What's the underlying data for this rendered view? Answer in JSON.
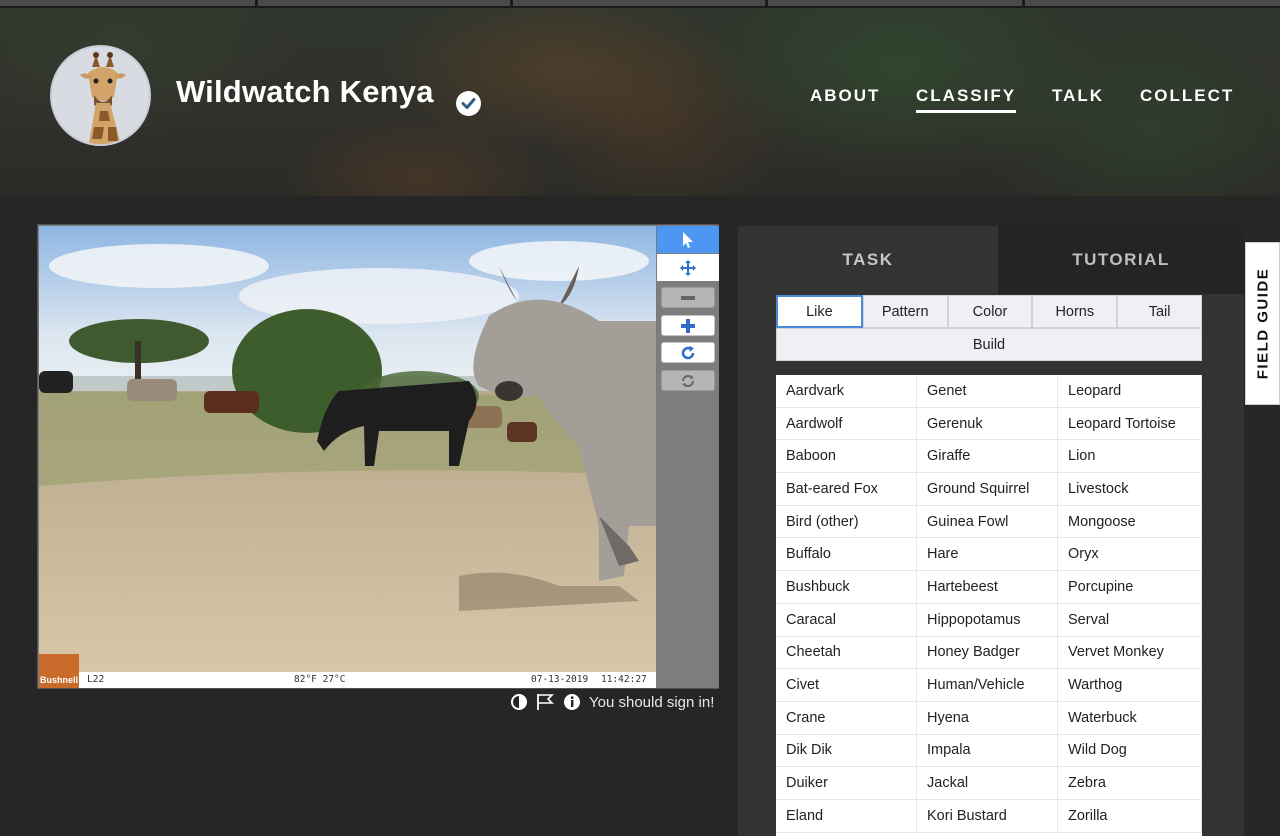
{
  "header": {
    "title": "Wildwatch Kenya",
    "nav": [
      {
        "label": "ABOUT",
        "active": false
      },
      {
        "label": "CLASSIFY",
        "active": true
      },
      {
        "label": "TALK",
        "active": false
      },
      {
        "label": "COLLECT",
        "active": false
      }
    ]
  },
  "subject": {
    "camera_brand": "Bushnell",
    "camera_id": "L22",
    "temperature": "82°F 27°C",
    "date": "07-13-2019",
    "time": "11:42:27"
  },
  "toolbar": {
    "tools": [
      "pointer-icon",
      "move-icon",
      "zoom-out-icon",
      "zoom-in-icon",
      "rotate-icon",
      "reset-icon"
    ],
    "accent": "#4d97f2"
  },
  "subject_meta": {
    "signin_text": "You should sign in!"
  },
  "task": {
    "tabs": [
      "TASK",
      "TUTORIAL"
    ],
    "filters": [
      "Like",
      "Pattern",
      "Color",
      "Horns",
      "Tail"
    ],
    "build_label": "Build",
    "choices": [
      "Aardvark",
      "Genet",
      "Leopard",
      "Aardwolf",
      "Gerenuk",
      "Leopard Tortoise",
      "Baboon",
      "Giraffe",
      "Lion",
      "Bat-eared Fox",
      "Ground Squirrel",
      "Livestock",
      "Bird (other)",
      "Guinea Fowl",
      "Mongoose",
      "Buffalo",
      "Hare",
      "Oryx",
      "Bushbuck",
      "Hartebeest",
      "Porcupine",
      "Caracal",
      "Hippopotamus",
      "Serval",
      "Cheetah",
      "Honey Badger",
      "Vervet Monkey",
      "Civet",
      "Human/Vehicle",
      "Warthog",
      "Crane",
      "Hyena",
      "Waterbuck",
      "Dik Dik",
      "Impala",
      "Wild Dog",
      "Duiker",
      "Jackal",
      "Zebra",
      "Eland",
      "Kori Bustard",
      "Zorilla"
    ]
  },
  "field_guide": {
    "label": "FIELD GUIDE"
  }
}
